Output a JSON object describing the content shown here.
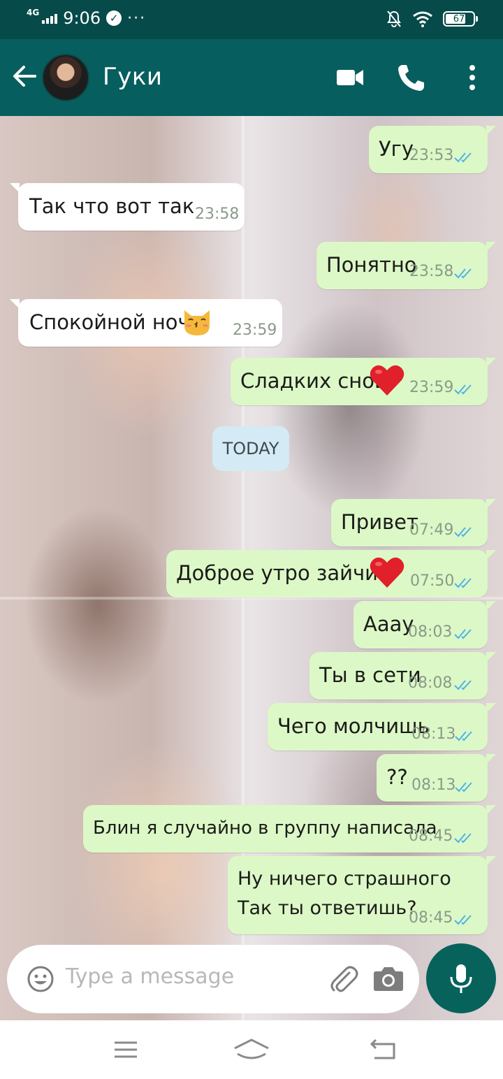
{
  "status_bar": {
    "network": "4G",
    "time": "9:06",
    "battery": "67"
  },
  "header": {
    "contact_name": "Гуки"
  },
  "messages": [
    {
      "dir": "out",
      "text": "Угу",
      "time": "23:53"
    },
    {
      "dir": "in",
      "text": "Так что вот так",
      "time": "23:58"
    },
    {
      "dir": "out",
      "text": "Понятно",
      "time": "23:58"
    },
    {
      "dir": "in",
      "text": "Спокойной ночи",
      "time": "23:59",
      "emoji": "kissing-cat"
    },
    {
      "dir": "out",
      "text": "Сладких снов",
      "time": "23:59",
      "emoji": "red-heart"
    },
    {
      "dir": "out",
      "text": "Привет",
      "time": "07:49"
    },
    {
      "dir": "out",
      "text": "Доброе утро зайчик",
      "time": "07:50",
      "emoji": "red-heart"
    },
    {
      "dir": "out",
      "text": "Аааy",
      "time": "08:03"
    },
    {
      "dir": "out",
      "text": "Ты в сети",
      "time": "08:08"
    },
    {
      "dir": "out",
      "text": "Чего молчишь",
      "time": "08:13"
    },
    {
      "dir": "out",
      "text": "??",
      "time": "08:13"
    },
    {
      "dir": "out",
      "text": "Блин я случайно в группу написала",
      "time": "08:45"
    },
    {
      "dir": "out",
      "text": "Ну ничего страшного\nТак ты ответишь?",
      "time": "08:45"
    }
  ],
  "date_separator": "TODAY",
  "composer": {
    "placeholder": "Type a message"
  },
  "colors": {
    "header": "#075e5e",
    "status_bar": "#074a4a",
    "outgoing_bubble": "#dcf8c6",
    "incoming_bubble": "#ffffff",
    "read_ticks": "#4fb3e8",
    "mic_button": "#07625c"
  },
  "icons": {
    "header": [
      "back-arrow-icon",
      "video-call-icon",
      "phone-icon",
      "more-vert-icon"
    ],
    "composer": [
      "emoji-icon",
      "attach-icon",
      "camera-icon",
      "mic-icon"
    ],
    "navigation": [
      "menu-icon",
      "home-icon",
      "back-icon"
    ]
  }
}
